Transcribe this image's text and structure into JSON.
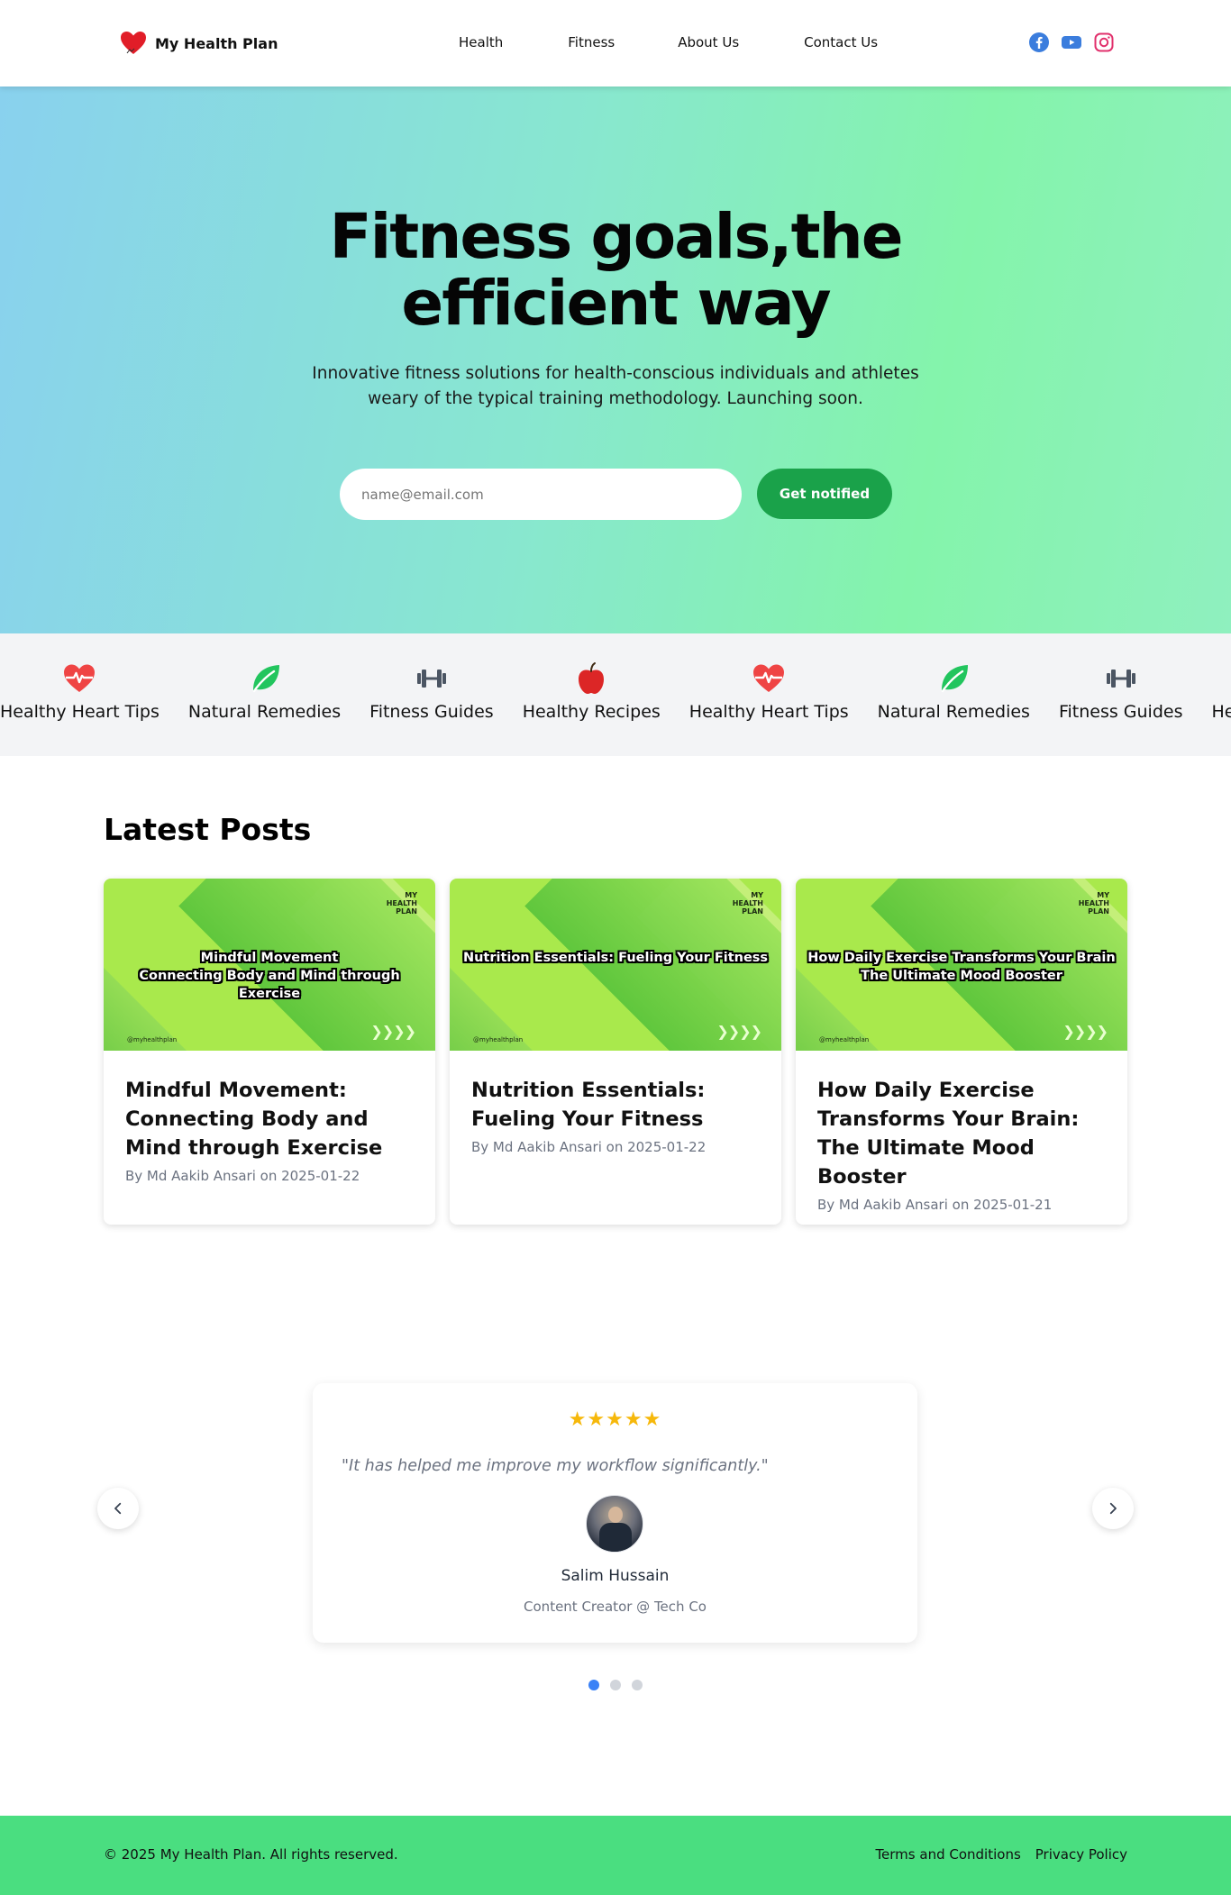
{
  "header": {
    "brand_name": "My Health Plan",
    "nav": [
      "Health",
      "Fitness",
      "About Us",
      "Contact Us"
    ],
    "social_icons": [
      "facebook-icon",
      "youtube-icon",
      "instagram-icon"
    ]
  },
  "hero": {
    "title": "Fitness goals,the efficient way",
    "subtitle": "Innovative fitness solutions for health-conscious individuals and athletes weary of the typical training methodology. Launching soon.",
    "email_placeholder": "name@email.com",
    "button_label": "Get notified"
  },
  "categories": [
    {
      "label": "Healthy Heart Tips",
      "icon": "heart-pulse-icon"
    },
    {
      "label": "Natural Remedies",
      "icon": "leaf-icon"
    },
    {
      "label": "Fitness Guides",
      "icon": "dumbbell-icon"
    },
    {
      "label": "Healthy Recipes",
      "icon": "apple-icon"
    },
    {
      "label": "Healthy Heart Tips",
      "icon": "heart-pulse-icon"
    },
    {
      "label": "Natural Remedies",
      "icon": "leaf-icon"
    },
    {
      "label": "Fitness Guides",
      "icon": "dumbbell-icon"
    },
    {
      "label": "Healthy Recipes",
      "icon": "apple-icon"
    }
  ],
  "posts": {
    "section_title": "Latest Posts",
    "items": [
      {
        "thumb_brand": "MY HEALTH PLAN",
        "thumb_caption": "Mindful Movement\nConnecting Body and Mind through Exercise",
        "thumb_handle": "@myhealthplan",
        "title": "Mindful Movement: Connecting Body and Mind through Exercise",
        "meta": "By Md Aakib Ansari on 2025-01-22"
      },
      {
        "thumb_brand": "MY HEALTH PLAN",
        "thumb_caption": "Nutrition Essentials: Fueling Your Fitness",
        "thumb_handle": "@myhealthplan",
        "title": "Nutrition Essentials: Fueling Your Fitness",
        "meta": "By Md Aakib Ansari on 2025-01-22"
      },
      {
        "thumb_brand": "MY HEALTH PLAN",
        "thumb_caption": "How Daily Exercise Transforms Your Brain\nThe Ultimate Mood Booster",
        "thumb_handle": "@myhealthplan",
        "title": "How Daily Exercise Transforms Your Brain: The Ultimate Mood Booster",
        "meta": "By Md Aakib Ansari on 2025-01-21"
      }
    ]
  },
  "testimonial": {
    "rating": 5,
    "stars": "★★★★★",
    "quote": "\"It has helped me improve my workflow significantly.\"",
    "name": "Salim Hussain",
    "role": "Content Creator @ Tech Co",
    "slide_count": 3,
    "active_slide": 1
  },
  "footer": {
    "copyright": "© 2025 My Health Plan. All rights reserved.",
    "links": [
      "Terms and Conditions",
      "Privacy Policy"
    ]
  }
}
